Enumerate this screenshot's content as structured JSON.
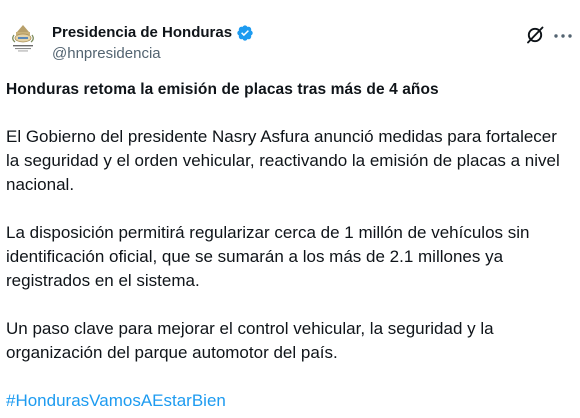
{
  "author": {
    "display_name": "Presidencia de Honduras",
    "handle": "@hnpresidencia",
    "verified_icon": "verified-badge-icon",
    "accent_color": "#1d9bf0"
  },
  "actions": {
    "grok_icon": "grok-icon",
    "more_icon": "more-options-icon"
  },
  "post": {
    "headline": "Honduras retoma la emisión de placas tras más de 4 años",
    "paragraphs": [
      "El Gobierno del presidente Nasry Asfura anunció medidas para fortalecer la seguridad y el orden vehicular, reactivando la emisión de placas a nivel nacional.",
      "La disposición permitirá regularizar cerca de 1 millón de vehículos sin identificación oficial, que se sumarán a los más de 2.1 millones ya registrados en el sistema.",
      "Un paso clave para mejorar el control vehicular, la seguridad y la organización del parque automotor del país."
    ],
    "hashtag": "#HondurasVamosAEstarBien"
  }
}
